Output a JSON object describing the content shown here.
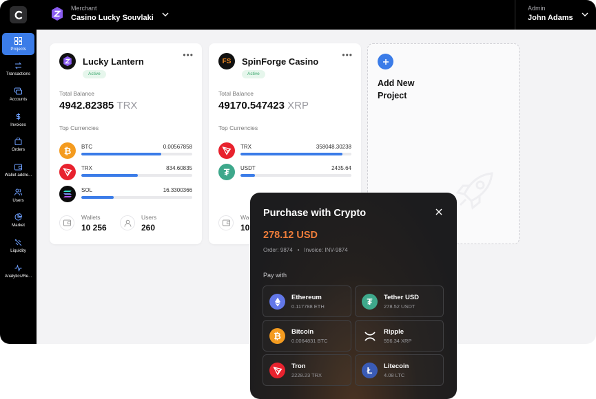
{
  "header": {
    "merchant_caption": "Merchant",
    "merchant_name": "Casino Lucky Souvlaki",
    "admin_caption": "Admin",
    "admin_name": "John Adams"
  },
  "sidebar": {
    "items": [
      {
        "label": "Projects",
        "icon": "grid-icon"
      },
      {
        "label": "Transactions",
        "icon": "arrows-icon"
      },
      {
        "label": "Accounts",
        "icon": "cards-icon"
      },
      {
        "label": "Invoices",
        "icon": "dollar-icon"
      },
      {
        "label": "Orders",
        "icon": "bag-icon"
      },
      {
        "label": "Wallet addre...",
        "icon": "wallet-icon"
      },
      {
        "label": "Users",
        "icon": "users-icon"
      },
      {
        "label": "Market",
        "icon": "pie-icon"
      },
      {
        "label": "Liquidity",
        "icon": "liquidity-icon"
      },
      {
        "label": "Analytics/Re...",
        "icon": "pulse-icon"
      }
    ]
  },
  "projects": [
    {
      "name": "Lucky Lantern",
      "status": "Active",
      "total_balance_label": "Total Balance",
      "balance": "4942.82385",
      "balance_currency": "TRX",
      "top_currencies_label": "Top Currencies",
      "currencies": [
        {
          "code": "BTC",
          "amount": "0.00567858",
          "fill": 0.72
        },
        {
          "code": "TRX",
          "amount": "834.60835",
          "fill": 0.51
        },
        {
          "code": "SOL",
          "amount": "16.3300366",
          "fill": 0.29
        }
      ],
      "wallets_label": "Wallets",
      "wallets": "10 256",
      "users_label": "Users",
      "users": "260"
    },
    {
      "name": "SpinForge Casino",
      "status": "Active",
      "total_balance_label": "Total Balance",
      "balance": "49170.547423",
      "balance_currency": "XRP",
      "top_currencies_label": "Top Currencies",
      "currencies": [
        {
          "code": "TRX",
          "amount": "358048.30238",
          "fill": 0.92
        },
        {
          "code": "USDT",
          "amount": "2435.64",
          "fill": 0.13
        }
      ],
      "wallets_label": "Wa",
      "wallets": "10"
    }
  ],
  "add_new": {
    "label": "Add New Project"
  },
  "purchase": {
    "title": "Purchase with Crypto",
    "amount": "278.12 USD",
    "order": "Order: 9874",
    "separator": "•",
    "invoice": "Invoice: INV-9874",
    "pay_with": "Pay with",
    "options": [
      {
        "name": "Ethereum",
        "balance": "0.117788 ETH",
        "icon": "ethereum-icon",
        "color": "#6277e8"
      },
      {
        "name": "Tether USD",
        "balance": "278.52 USDT",
        "icon": "tether-icon",
        "color": "#3ea88b"
      },
      {
        "name": "Bitcoin",
        "balance": "0.0064831 BTC",
        "icon": "bitcoin-icon",
        "color": "#f49b1f"
      },
      {
        "name": "Ripple",
        "balance": "556.34 XRP",
        "icon": "ripple-icon",
        "color": "#ffffff"
      },
      {
        "name": "Tron",
        "balance": "2228.23 TRX",
        "icon": "tron-icon",
        "color": "#e8222e"
      },
      {
        "name": "Litecoin",
        "balance": "4.08 LTC",
        "icon": "litecoin-icon",
        "color": "#3a5bb5"
      }
    ]
  },
  "colors": {
    "accent": "#3b7ce8",
    "amount": "#ef7d3a",
    "active_badge": "#3aa76d"
  }
}
